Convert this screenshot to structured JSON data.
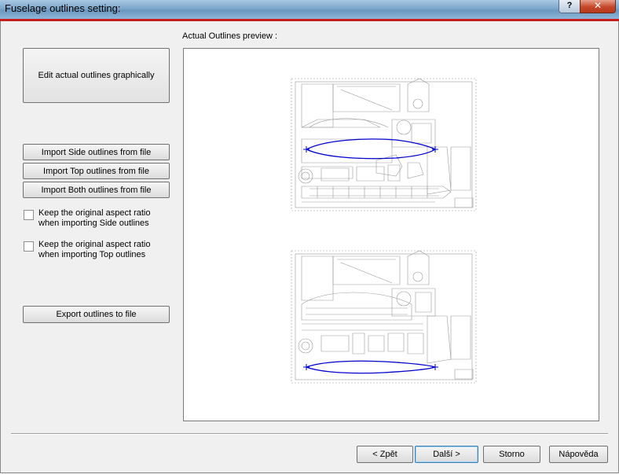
{
  "window": {
    "title": "Fuselage outlines setting:",
    "help_label": "?",
    "close_label": "✕"
  },
  "left": {
    "edit_button": "Edit actual outlines graphically",
    "import_side_button": "Import Side outlines from file",
    "import_top_button": "Import Top outlines from file",
    "import_both_button": "Import Both outlines from file",
    "keep_side_label": "Keep the original aspect ratio when importing Side outlines",
    "keep_side_checked": false,
    "keep_top_label": "Keep the original aspect ratio when importing Top outlines",
    "keep_top_checked": false,
    "export_button": "Export outlines to file"
  },
  "preview": {
    "label": "Actual Outlines preview :",
    "outline_color": "#0000cc"
  },
  "footer": {
    "back_button": "< Zpět",
    "next_button": "Další >",
    "cancel_button": "Storno",
    "help_button": "Nápověda"
  }
}
